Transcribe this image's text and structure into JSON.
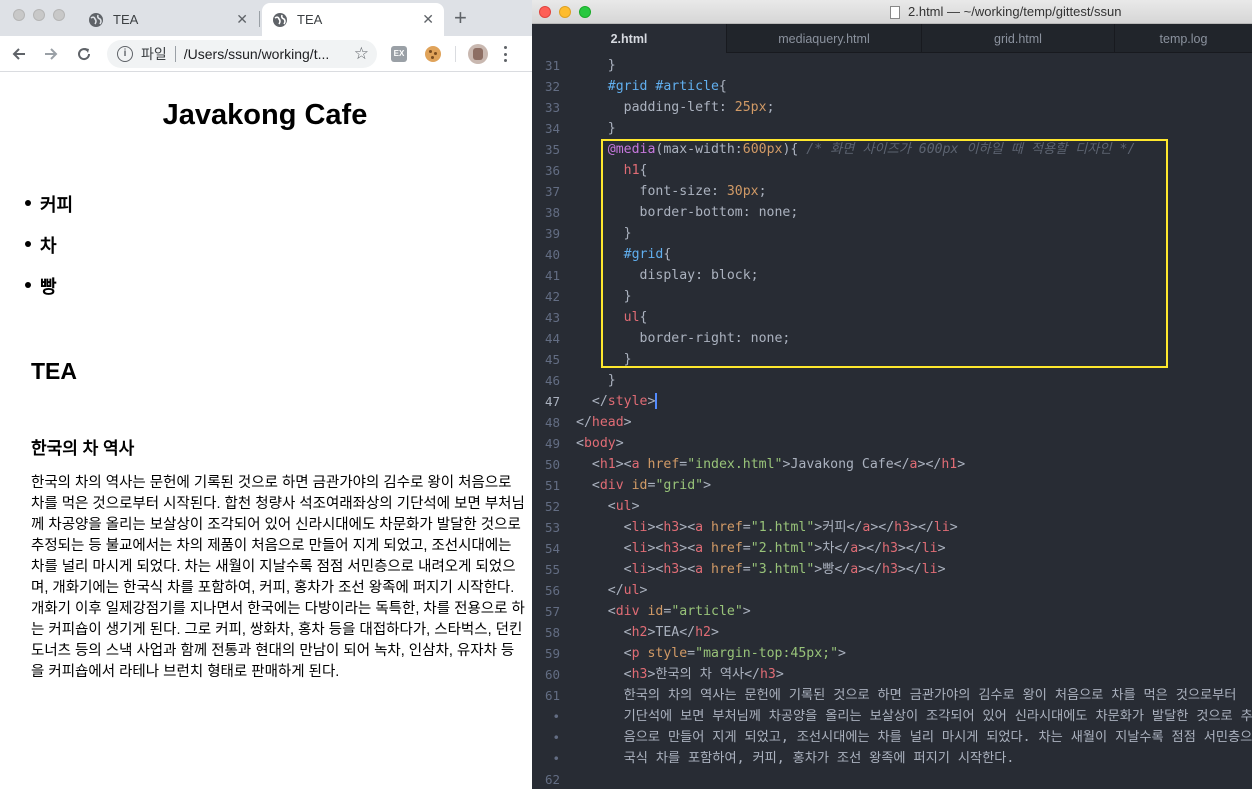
{
  "browser": {
    "tabs": [
      {
        "label": "TEA",
        "active": false
      },
      {
        "label": "TEA",
        "active": true
      }
    ],
    "new_tab_symbol": "+",
    "address": {
      "scheme_label": "파일",
      "url": "/Users/ssun/working/t..."
    },
    "extensions": [
      "ex-extension-icon",
      "cookie-extension-icon"
    ],
    "page": {
      "site_title": "Javakong Cafe",
      "menu": [
        "커피",
        "차",
        "빵"
      ],
      "article_heading": "TEA",
      "history_heading": "한국의 차 역사",
      "paragraph": "한국의 차의 역사는 문헌에 기록된 것으로 하면 금관가야의 김수로 왕이 처음으로 차를 먹은 것으로부터 시작된다. 합천 청량사 석조여래좌상의 기단석에 보면 부처님께 차공양을 올리는 보살상이 조각되어 있어 신라시대에도 차문화가 발달한 것으로 추정되는 등 불교에서는 차의 제품이 처음으로 만들어 지게 되었고, 조선시대에는 차를 널리 마시게 되었다. 차는 새월이 지날수록 점점 서민층으로 내려오게 되었으며, 개화기에는 한국식 차를 포함하여, 커피, 홍차가 조선 왕족에 퍼지기 시작한다. 개화기 이후 일제강점기를 지나면서 한국에는 다방이라는 독특한, 차를 전용으로 하는 커피숍이 생기게 된다. 그로 커피, 쌍화차, 홍차 등을 대접하다가, 스타벅스, 던킨도너츠 등의 스낵 사업과 함께 전통과 현대의 만남이 되어 녹차, 인삼차, 유자차 등을 커피숍에서 라테나 브런치 형태로 판매하게 된다."
    }
  },
  "editor": {
    "window_title": "2.html — ~/working/temp/gittest/ssun",
    "tabs": [
      "2.html",
      "mediaquery.html",
      "grid.html",
      "temp.log"
    ],
    "active_tab": "2.html",
    "highlight_color": "#ffe82d",
    "gutter": [
      "31",
      "32",
      "33",
      "34",
      "35",
      "36",
      "37",
      "38",
      "39",
      "40",
      "41",
      "42",
      "43",
      "44",
      "45",
      "46",
      "47",
      "48",
      "49",
      "50",
      "51",
      "52",
      "53",
      "54",
      "55",
      "56",
      "57",
      "58",
      "59",
      "60",
      "61",
      "•",
      "•",
      "•",
      "62"
    ],
    "current_line": "47",
    "lines": [
      [
        [
          "t-txt",
          "    }"
        ]
      ],
      [
        [
          "t-sel",
          "    #grid #article"
        ],
        [
          "t-txt",
          "{"
        ]
      ],
      [
        [
          "t-prop",
          "      padding-left: "
        ],
        [
          "t-num",
          "25px"
        ],
        [
          "t-txt",
          ";"
        ]
      ],
      [
        [
          "t-txt",
          "    }"
        ]
      ],
      [
        [
          "t-kw",
          "    @media"
        ],
        [
          "t-txt",
          "(max-width:"
        ],
        [
          "t-num",
          "600px"
        ],
        [
          "t-txt",
          ")"
        ],
        [
          "t-txt",
          "{ "
        ],
        [
          "t-com",
          "/* 화면 사이즈가 600px 이하일 때 적용할 디자인 */"
        ]
      ],
      [
        [
          "t-tag",
          "      h1"
        ],
        [
          "t-txt",
          "{"
        ]
      ],
      [
        [
          "t-prop",
          "        font-size: "
        ],
        [
          "t-num",
          "30px"
        ],
        [
          "t-txt",
          ";"
        ]
      ],
      [
        [
          "t-prop",
          "        border-bottom: none;"
        ]
      ],
      [
        [
          "t-txt",
          "      }"
        ]
      ],
      [
        [
          "t-sel",
          "      #grid"
        ],
        [
          "t-txt",
          "{"
        ]
      ],
      [
        [
          "t-prop",
          "        display: block;"
        ]
      ],
      [
        [
          "t-txt",
          "      }"
        ]
      ],
      [
        [
          "t-tag",
          "      ul"
        ],
        [
          "t-txt",
          "{"
        ]
      ],
      [
        [
          "t-prop",
          "        border-right: none;"
        ]
      ],
      [
        [
          "t-txt",
          "      }"
        ]
      ],
      [
        [
          "t-txt",
          "    }"
        ]
      ],
      [
        [
          "t-txt",
          "  </"
        ],
        [
          "t-tag",
          "style"
        ],
        [
          "t-txt",
          ">"
        ]
      ],
      [
        [
          "t-txt",
          "</"
        ],
        [
          "t-tag",
          "head"
        ],
        [
          "t-txt",
          ">"
        ]
      ],
      [
        [
          "t-txt",
          "<"
        ],
        [
          "t-tag",
          "body"
        ],
        [
          "t-txt",
          ">"
        ]
      ],
      [
        [
          "t-txt",
          "  <"
        ],
        [
          "t-tag",
          "h1"
        ],
        [
          "t-txt",
          "><"
        ],
        [
          "t-tag",
          "a"
        ],
        [
          "t-attr",
          " href"
        ],
        [
          "t-txt",
          "="
        ],
        [
          "t-str",
          "\"index.html\""
        ],
        [
          "t-txt",
          ">Javakong Cafe</"
        ],
        [
          "t-tag",
          "a"
        ],
        [
          "t-txt",
          "></"
        ],
        [
          "t-tag",
          "h1"
        ],
        [
          "t-txt",
          ">"
        ]
      ],
      [
        [
          "t-txt",
          "  <"
        ],
        [
          "t-tag",
          "div"
        ],
        [
          "t-attr",
          " id"
        ],
        [
          "t-txt",
          "="
        ],
        [
          "t-str",
          "\"grid\""
        ],
        [
          "t-txt",
          ">"
        ]
      ],
      [
        [
          "t-txt",
          "    <"
        ],
        [
          "t-tag",
          "ul"
        ],
        [
          "t-txt",
          ">"
        ]
      ],
      [
        [
          "t-txt",
          "      <"
        ],
        [
          "t-tag",
          "li"
        ],
        [
          "t-txt",
          "><"
        ],
        [
          "t-tag",
          "h3"
        ],
        [
          "t-txt",
          "><"
        ],
        [
          "t-tag",
          "a"
        ],
        [
          "t-attr",
          " href"
        ],
        [
          "t-txt",
          "="
        ],
        [
          "t-str",
          "\"1.html\""
        ],
        [
          "t-txt",
          ">커피</"
        ],
        [
          "t-tag",
          "a"
        ],
        [
          "t-txt",
          "></"
        ],
        [
          "t-tag",
          "h3"
        ],
        [
          "t-txt",
          "></"
        ],
        [
          "t-tag",
          "li"
        ],
        [
          "t-txt",
          ">"
        ]
      ],
      [
        [
          "t-txt",
          "      <"
        ],
        [
          "t-tag",
          "li"
        ],
        [
          "t-txt",
          "><"
        ],
        [
          "t-tag",
          "h3"
        ],
        [
          "t-txt",
          "><"
        ],
        [
          "t-tag",
          "a"
        ],
        [
          "t-attr",
          " href"
        ],
        [
          "t-txt",
          "="
        ],
        [
          "t-str",
          "\"2.html\""
        ],
        [
          "t-txt",
          ">차</"
        ],
        [
          "t-tag",
          "a"
        ],
        [
          "t-txt",
          "></"
        ],
        [
          "t-tag",
          "h3"
        ],
        [
          "t-txt",
          "></"
        ],
        [
          "t-tag",
          "li"
        ],
        [
          "t-txt",
          ">"
        ]
      ],
      [
        [
          "t-txt",
          "      <"
        ],
        [
          "t-tag",
          "li"
        ],
        [
          "t-txt",
          "><"
        ],
        [
          "t-tag",
          "h3"
        ],
        [
          "t-txt",
          "><"
        ],
        [
          "t-tag",
          "a"
        ],
        [
          "t-attr",
          " href"
        ],
        [
          "t-txt",
          "="
        ],
        [
          "t-str",
          "\"3.html\""
        ],
        [
          "t-txt",
          ">빵</"
        ],
        [
          "t-tag",
          "a"
        ],
        [
          "t-txt",
          "></"
        ],
        [
          "t-tag",
          "h3"
        ],
        [
          "t-txt",
          "></"
        ],
        [
          "t-tag",
          "li"
        ],
        [
          "t-txt",
          ">"
        ]
      ],
      [
        [
          "t-txt",
          "    </"
        ],
        [
          "t-tag",
          "ul"
        ],
        [
          "t-txt",
          ">"
        ]
      ],
      [
        [
          "t-txt",
          "    <"
        ],
        [
          "t-tag",
          "div"
        ],
        [
          "t-attr",
          " id"
        ],
        [
          "t-txt",
          "="
        ],
        [
          "t-str",
          "\"article\""
        ],
        [
          "t-txt",
          ">"
        ]
      ],
      [
        [
          "t-txt",
          "      <"
        ],
        [
          "t-tag",
          "h2"
        ],
        [
          "t-txt",
          ">TEA</"
        ],
        [
          "t-tag",
          "h2"
        ],
        [
          "t-txt",
          ">"
        ]
      ],
      [
        [
          "t-txt",
          "      <"
        ],
        [
          "t-tag",
          "p"
        ],
        [
          "t-attr",
          " style"
        ],
        [
          "t-txt",
          "="
        ],
        [
          "t-str",
          "\"margin-top:45px;\""
        ],
        [
          "t-txt",
          ">"
        ]
      ],
      [
        [
          "t-txt",
          "      <"
        ],
        [
          "t-tag",
          "h3"
        ],
        [
          "t-txt",
          ">한국의 차 역사</"
        ],
        [
          "t-tag",
          "h3"
        ],
        [
          "t-txt",
          ">"
        ]
      ],
      [
        [
          "t-txt",
          "      한국의 차의 역사는 문헌에 기록된 것으로 하면 금관가야의 김수로 왕이 처음으로 차를 먹은 것으로부터"
        ]
      ],
      [
        [
          "t-txt",
          "      기단석에 보면 부처님께 차공양을 올리는 보살상이 조각되어 있어 신라시대에도 차문화가 발달한 것으로 추"
        ]
      ],
      [
        [
          "t-txt",
          "      음으로 만들어 지게 되었고, 조선시대에는 차를 널리 마시게 되었다. 차는 새월이 지날수록 점점 서민층으"
        ]
      ],
      [
        [
          "t-txt",
          "      국식 차를 포함하여, 커피, 홍차가 조선 왕족에 퍼지기 시작한다."
        ]
      ],
      [
        [
          "t-txt",
          ""
        ]
      ]
    ]
  }
}
